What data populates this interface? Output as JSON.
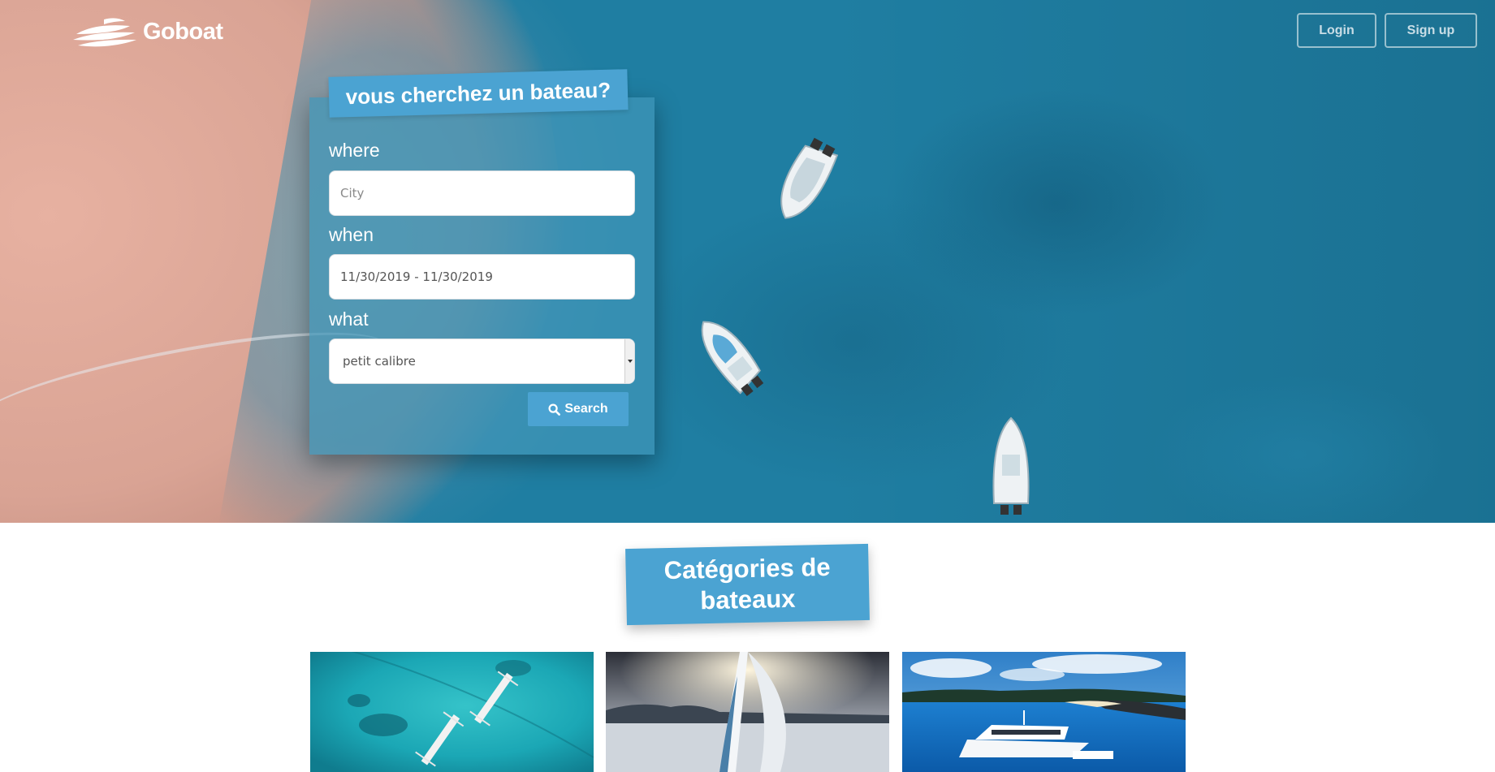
{
  "brand": {
    "name": "Goboat",
    "logo_icon": "boat-waves-icon"
  },
  "header": {
    "login_label": "Login",
    "signup_label": "Sign up"
  },
  "search": {
    "title": "vous cherchez un bateau?",
    "where_label": "where",
    "where_placeholder": "City",
    "when_label": "when",
    "when_value": "11/30/2019 - 11/30/2019",
    "what_label": "what",
    "what_value": "petit calibre",
    "button_label": "Search",
    "button_icon": "search-icon"
  },
  "categories": {
    "title": "Catégories de bateaux",
    "cards": [
      {
        "image": "aerial-outrigger-boats-image"
      },
      {
        "image": "sailboat-image"
      },
      {
        "image": "motor-yacht-image"
      }
    ]
  },
  "colors": {
    "accent": "#4ba3d2",
    "sea": "#1f7ea2",
    "sand": "#d9a394"
  }
}
